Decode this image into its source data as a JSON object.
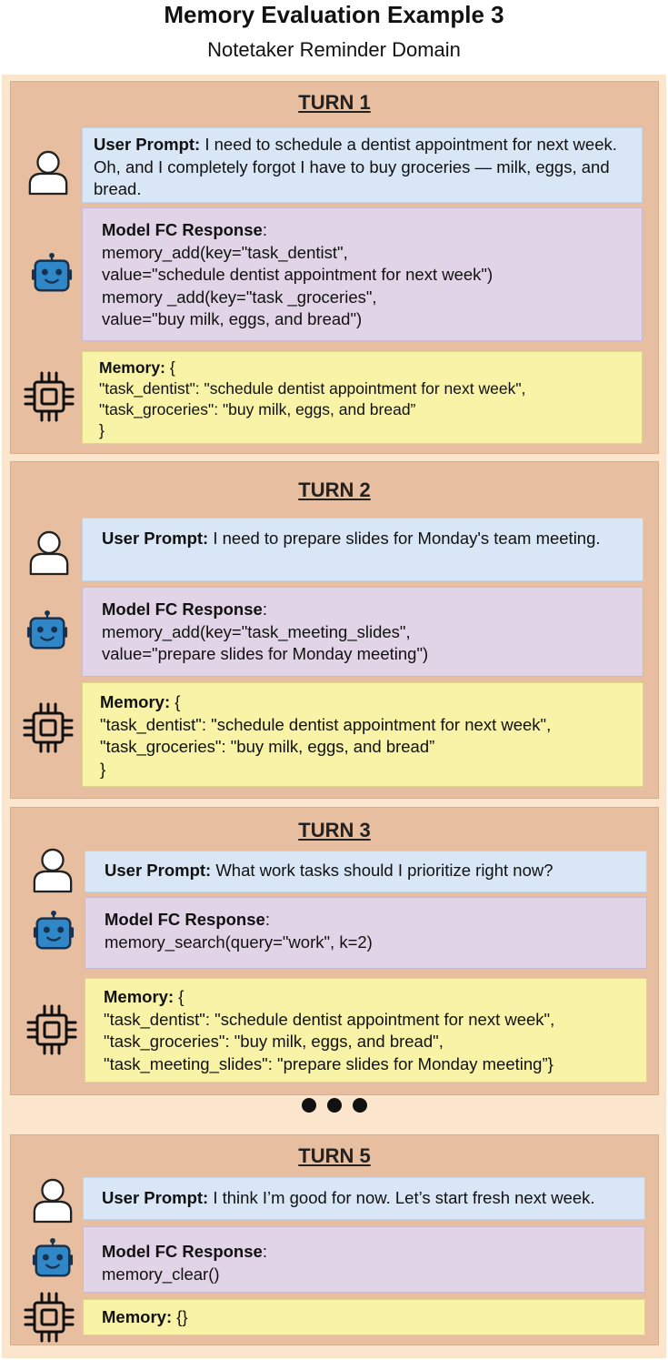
{
  "header": {
    "title": "Memory Evaluation Example 3",
    "subtitle": "Notetaker Reminder Domain"
  },
  "labels": {
    "user_prompt": "User Prompt:",
    "model_fc": "Model FC Response",
    "colon": ":",
    "memory": "Memory:"
  },
  "icons": [
    "user-icon",
    "robot-icon",
    "chip-icon"
  ],
  "colors": {
    "outer_bg": "#fbe5cd",
    "turn_bg": "#e8bea0",
    "user_box": "#d9e6f6",
    "model_box": "#e1d4e6",
    "memory_box": "#f8f3a7",
    "robot_blue": "#2f87c8"
  },
  "turns": [
    {
      "title": "TURN 1",
      "user_text": "I need to schedule a dentist appointment for next week. Oh, and I completely forgot I have to buy groceries — milk, eggs, and bread.",
      "model_lines": [
        "memory_add(key=\"task_dentist\",",
        "value=\"schedule dentist appointment for next week\")",
        "memory _add(key=\"task _groceries\",",
        "value=\"buy milk, eggs, and bread\")"
      ],
      "memory_open": "{",
      "memory_lines": [
        "\"task_dentist\": \"schedule dentist appointment for next week\",",
        "\"task_groceries\": \"buy milk, eggs, and bread”",
        "}"
      ]
    },
    {
      "title": "TURN 2",
      "user_text": "I need to prepare slides for Monday's team meeting.",
      "model_lines": [
        "memory_add(key=\"task_meeting_slides\",",
        "value=\"prepare slides for Monday meeting\")"
      ],
      "memory_open": "{",
      "memory_lines": [
        "\"task_dentist\": \"schedule dentist appointment for next week\",",
        "\"task_groceries\": \"buy milk, eggs, and bread”",
        "}"
      ]
    },
    {
      "title": "TURN 3",
      "user_text": "What work tasks should I prioritize right now?",
      "model_lines": [
        "memory_search(query=\"work\", k=2)"
      ],
      "memory_open": "{",
      "memory_lines": [
        "\"task_dentist\": \"schedule dentist appointment for next week\",",
        "\"task_groceries\": \"buy milk, eggs, and bread\",",
        "\"task_meeting_slides\": \"prepare slides for Monday meeting”}"
      ]
    },
    {
      "title": "TURN 5",
      "user_text": "I think I’m good for now. Let’s start fresh next week.",
      "model_lines": [
        "memory_clear()"
      ],
      "memory_open": "{}",
      "memory_lines": []
    }
  ]
}
